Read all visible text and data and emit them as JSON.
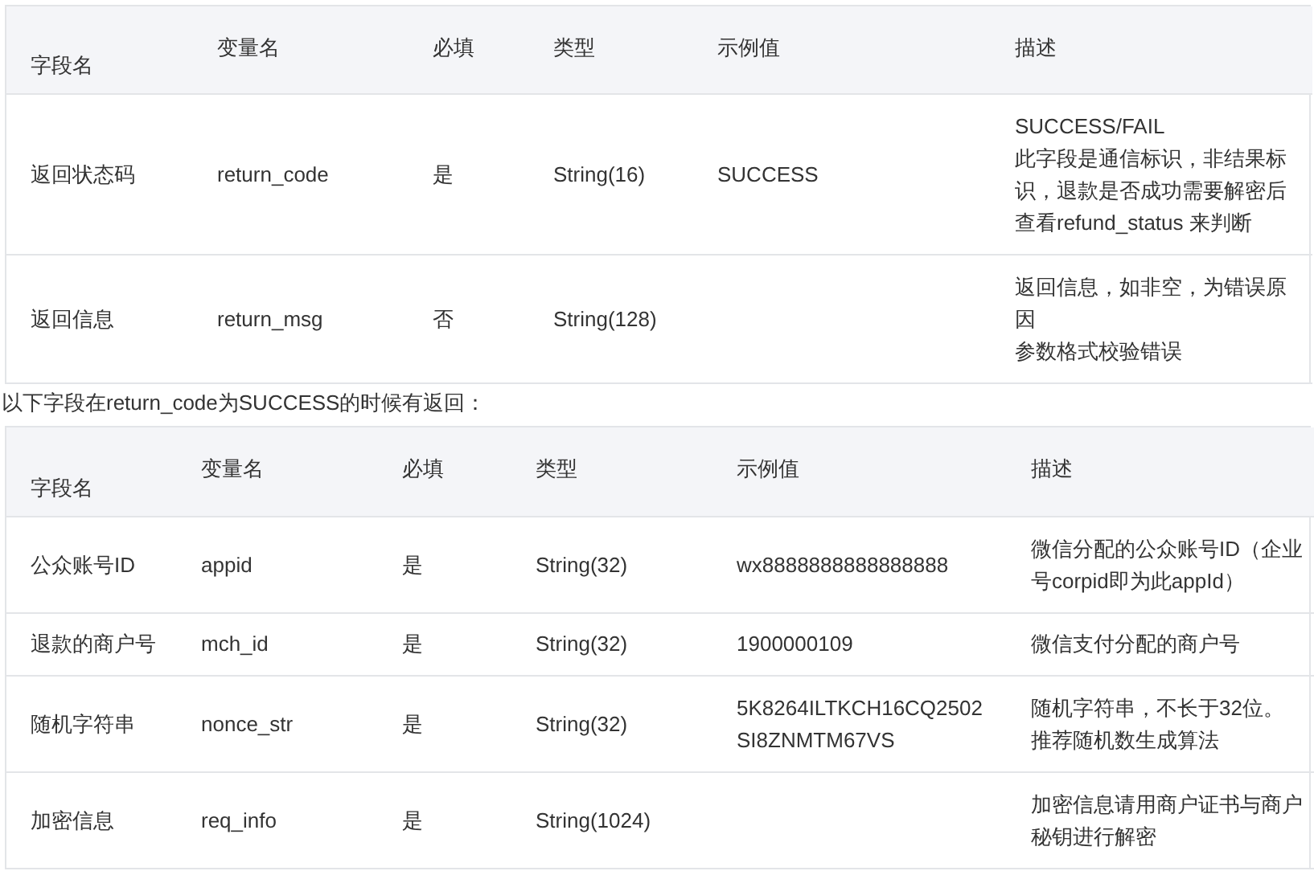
{
  "tables": [
    {
      "columns": [
        "字段名",
        "变量名",
        "必填",
        "类型",
        "示例值",
        "描述"
      ],
      "rows": [
        {
          "cells": [
            [
              "返回状态码"
            ],
            [
              "return_code"
            ],
            [
              "是"
            ],
            [
              "String(16)"
            ],
            [
              "SUCCESS"
            ],
            [
              "SUCCESS/FAIL",
              "此字段是通信标识，非结果标",
              "识，退款是否成功需要解密后",
              "查看refund_status 来判断"
            ]
          ]
        },
        {
          "cells": [
            [
              "返回信息"
            ],
            [
              "return_msg"
            ],
            [
              "否"
            ],
            [
              "String(128)"
            ],
            [],
            [
              "返回信息，如非空，为错误原",
              "因",
              "参数格式校验错误"
            ]
          ]
        }
      ]
    },
    {
      "caption": "以下字段在return_code为SUCCESS的时候有返回：",
      "columns": [
        "字段名",
        "变量名",
        "必填",
        "类型",
        "示例值",
        "描述"
      ],
      "rows": [
        {
          "cells": [
            [
              "公众账号ID"
            ],
            [
              "appid"
            ],
            [
              "是"
            ],
            [
              "String(32)"
            ],
            [
              "wx8888888888888888"
            ],
            [
              "微信分配的公众账号ID（企业",
              "号corpid即为此appId）"
            ]
          ]
        },
        {
          "cells": [
            [
              "退款的商户号"
            ],
            [
              "mch_id"
            ],
            [
              "是"
            ],
            [
              "String(32)"
            ],
            [
              "1900000109"
            ],
            [
              "微信支付分配的商户号"
            ]
          ]
        },
        {
          "cells": [
            [
              "随机字符串"
            ],
            [
              "nonce_str"
            ],
            [
              "是"
            ],
            [
              "String(32)"
            ],
            [
              "5K8264ILTKCH16CQ2502",
              "SI8ZNMTM67VS"
            ],
            [
              "随机字符串，不长于32位。",
              "推荐随机数生成算法"
            ]
          ]
        },
        {
          "cells": [
            [
              "加密信息"
            ],
            [
              "req_info"
            ],
            [
              "是"
            ],
            [
              "String(1024)"
            ],
            [],
            [
              "加密信息请用商户证书与商户",
              "秘钥进行解密"
            ]
          ]
        }
      ]
    }
  ]
}
